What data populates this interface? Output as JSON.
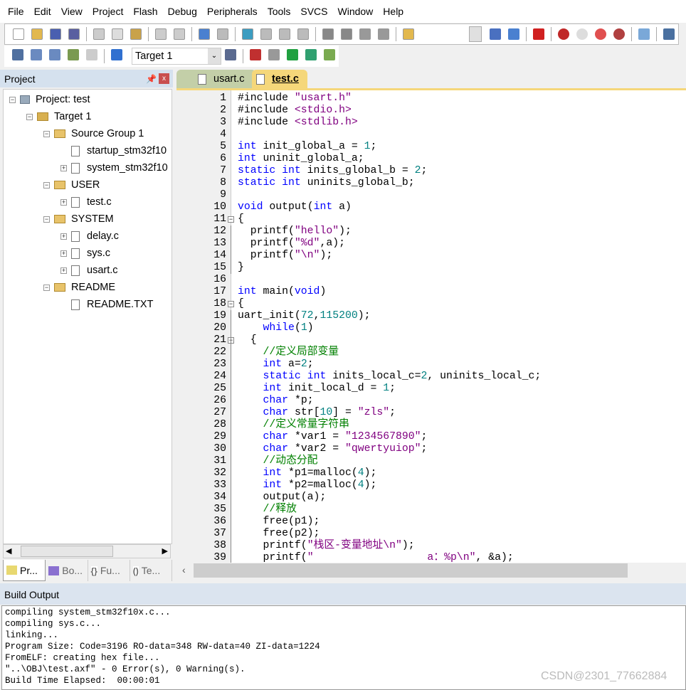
{
  "menu": [
    "File",
    "Edit",
    "View",
    "Project",
    "Flash",
    "Debug",
    "Peripherals",
    "Tools",
    "SVCS",
    "Window",
    "Help"
  ],
  "toolbar": {
    "target": "Target 1"
  },
  "project": {
    "title": "Project",
    "tree": [
      {
        "label": "Project: test",
        "depth": 0,
        "type": "root"
      },
      {
        "label": "Target 1",
        "depth": 1,
        "type": "target"
      },
      {
        "label": "Source Group 1",
        "depth": 2,
        "type": "folder"
      },
      {
        "label": "startup_stm32f10",
        "depth": 3,
        "type": "file"
      },
      {
        "label": "system_stm32f10",
        "depth": 3,
        "type": "file"
      },
      {
        "label": "USER",
        "depth": 2,
        "type": "folder"
      },
      {
        "label": "test.c",
        "depth": 3,
        "type": "file"
      },
      {
        "label": "SYSTEM",
        "depth": 2,
        "type": "folder"
      },
      {
        "label": "delay.c",
        "depth": 3,
        "type": "file"
      },
      {
        "label": "sys.c",
        "depth": 3,
        "type": "file"
      },
      {
        "label": "usart.c",
        "depth": 3,
        "type": "file"
      },
      {
        "label": "README",
        "depth": 2,
        "type": "folder"
      },
      {
        "label": "README.TXT",
        "depth": 3,
        "type": "file"
      }
    ],
    "bottom_tabs": [
      "Pr...",
      "Bo...",
      "Fu...",
      "Te..."
    ]
  },
  "editor": {
    "tabs": [
      {
        "label": "usart.c",
        "active": false
      },
      {
        "label": "test.c",
        "active": true
      }
    ],
    "lines": [
      [
        [
          "p",
          "#include "
        ],
        [
          "s",
          "\"usart.h\""
        ]
      ],
      [
        [
          "p",
          "#include "
        ],
        [
          "s",
          "<stdio.h>"
        ]
      ],
      [
        [
          "p",
          "#include "
        ],
        [
          "s",
          "<stdlib.h>"
        ]
      ],
      [],
      [
        [
          "k",
          "int"
        ],
        [
          "p",
          " init_global_a = "
        ],
        [
          "n",
          "1"
        ],
        [
          "p",
          ";"
        ]
      ],
      [
        [
          "k",
          "int"
        ],
        [
          "p",
          " uninit_global_a;"
        ]
      ],
      [
        [
          "k",
          "static int"
        ],
        [
          "p",
          " inits_global_b = "
        ],
        [
          "n",
          "2"
        ],
        [
          "p",
          ";"
        ]
      ],
      [
        [
          "k",
          "static int"
        ],
        [
          "p",
          " uninits_global_b;"
        ]
      ],
      [],
      [
        [
          "k",
          "void"
        ],
        [
          "p",
          " output("
        ],
        [
          "k",
          "int"
        ],
        [
          "p",
          " a)"
        ]
      ],
      [
        [
          "p",
          "{"
        ]
      ],
      [
        [
          "p",
          "  printf("
        ],
        [
          "s",
          "\"hello\""
        ],
        [
          "p",
          ");"
        ]
      ],
      [
        [
          "p",
          "  printf("
        ],
        [
          "s",
          "\"%d\""
        ],
        [
          "p",
          ",a);"
        ]
      ],
      [
        [
          "p",
          "  printf("
        ],
        [
          "s",
          "\"\\n\""
        ],
        [
          "p",
          ");"
        ]
      ],
      [
        [
          "p",
          "}"
        ]
      ],
      [],
      [
        [
          "k",
          "int"
        ],
        [
          "p",
          " main("
        ],
        [
          "k",
          "void"
        ],
        [
          "p",
          ")"
        ]
      ],
      [
        [
          "p",
          "{"
        ]
      ],
      [
        [
          "p",
          "uart_init("
        ],
        [
          "n",
          "72"
        ],
        [
          "p",
          ","
        ],
        [
          "n",
          "115200"
        ],
        [
          "p",
          ");"
        ]
      ],
      [
        [
          "p",
          "    "
        ],
        [
          "k",
          "while"
        ],
        [
          "p",
          "("
        ],
        [
          "n",
          "1"
        ],
        [
          "p",
          ")"
        ]
      ],
      [
        [
          "p",
          "  {"
        ]
      ],
      [
        [
          "p",
          "    "
        ],
        [
          "c",
          "//定义局部变量"
        ]
      ],
      [
        [
          "p",
          "    "
        ],
        [
          "k",
          "int"
        ],
        [
          "p",
          " a="
        ],
        [
          "n",
          "2"
        ],
        [
          "p",
          ";"
        ]
      ],
      [
        [
          "p",
          "    "
        ],
        [
          "k",
          "static int"
        ],
        [
          "p",
          " inits_local_c="
        ],
        [
          "n",
          "2"
        ],
        [
          "p",
          ", uninits_local_c;"
        ]
      ],
      [
        [
          "p",
          "    "
        ],
        [
          "k",
          "int"
        ],
        [
          "p",
          " init_local_d = "
        ],
        [
          "n",
          "1"
        ],
        [
          "p",
          ";"
        ]
      ],
      [
        [
          "p",
          "    "
        ],
        [
          "k",
          "char"
        ],
        [
          "p",
          " *p;"
        ]
      ],
      [
        [
          "p",
          "    "
        ],
        [
          "k",
          "char"
        ],
        [
          "p",
          " str["
        ],
        [
          "n",
          "10"
        ],
        [
          "p",
          "] = "
        ],
        [
          "s",
          "\"zls\""
        ],
        [
          "p",
          ";"
        ]
      ],
      [
        [
          "p",
          "    "
        ],
        [
          "c",
          "//定义常量字符串"
        ]
      ],
      [
        [
          "p",
          "    "
        ],
        [
          "k",
          "char"
        ],
        [
          "p",
          " *var1 = "
        ],
        [
          "s",
          "\"1234567890\""
        ],
        [
          "p",
          ";"
        ]
      ],
      [
        [
          "p",
          "    "
        ],
        [
          "k",
          "char"
        ],
        [
          "p",
          " *var2 = "
        ],
        [
          "s",
          "\"qwertyuiop\""
        ],
        [
          "p",
          ";"
        ]
      ],
      [
        [
          "p",
          "    "
        ],
        [
          "c",
          "//动态分配"
        ]
      ],
      [
        [
          "p",
          "    "
        ],
        [
          "k",
          "int"
        ],
        [
          "p",
          " *p1=malloc("
        ],
        [
          "n",
          "4"
        ],
        [
          "p",
          ");"
        ]
      ],
      [
        [
          "p",
          "    "
        ],
        [
          "k",
          "int"
        ],
        [
          "p",
          " *p2=malloc("
        ],
        [
          "n",
          "4"
        ],
        [
          "p",
          ");"
        ]
      ],
      [
        [
          "p",
          "    output(a);"
        ]
      ],
      [
        [
          "p",
          "    "
        ],
        [
          "c",
          "//释放"
        ]
      ],
      [
        [
          "p",
          "    free(p1);"
        ]
      ],
      [
        [
          "p",
          "    free(p2);"
        ]
      ],
      [
        [
          "p",
          "    printf("
        ],
        [
          "s",
          "\"栈区-变量地址\\n\""
        ],
        [
          "p",
          ");"
        ]
      ],
      [
        [
          "p",
          "    printf("
        ],
        [
          "s",
          "\"                  a：%p\\n\""
        ],
        [
          "p",
          ", &a);"
        ]
      ]
    ],
    "fold_lines": [
      11,
      18,
      21
    ]
  },
  "build": {
    "title": "Build Output",
    "lines": [
      "compiling system_stm32f10x.c...",
      "compiling sys.c...",
      "linking...",
      "Program Size: Code=3196 RO-data=348 RW-data=40 ZI-data=1224",
      "FromELF: creating hex file...",
      "\"..\\OBJ\\test.axf\" - 0 Error(s), 0 Warning(s).",
      "Build Time Elapsed:  00:00:01"
    ]
  },
  "watermark": "CSDN@2301_77662884"
}
